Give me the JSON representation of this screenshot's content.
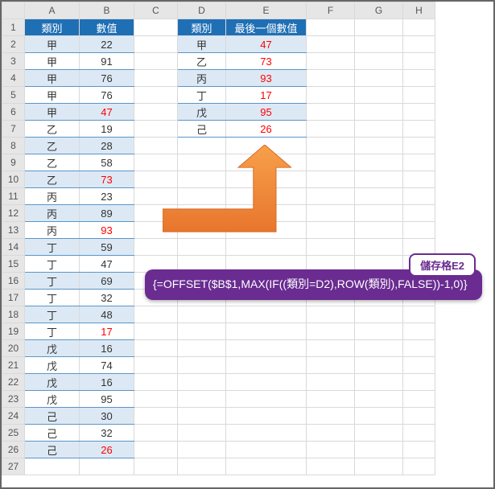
{
  "columns": [
    "A",
    "B",
    "C",
    "D",
    "E",
    "F",
    "G",
    "H"
  ],
  "tableA": {
    "headers": {
      "cat": "類別",
      "val": "數值"
    },
    "rows": [
      {
        "cat": "甲",
        "val": "22"
      },
      {
        "cat": "甲",
        "val": "91"
      },
      {
        "cat": "甲",
        "val": "76"
      },
      {
        "cat": "甲",
        "val": "76"
      },
      {
        "cat": "甲",
        "val": "47",
        "red": true
      },
      {
        "cat": "乙",
        "val": "19"
      },
      {
        "cat": "乙",
        "val": "28"
      },
      {
        "cat": "乙",
        "val": "58"
      },
      {
        "cat": "乙",
        "val": "73",
        "red": true
      },
      {
        "cat": "丙",
        "val": "23"
      },
      {
        "cat": "丙",
        "val": "89"
      },
      {
        "cat": "丙",
        "val": "93",
        "red": true
      },
      {
        "cat": "丁",
        "val": "59"
      },
      {
        "cat": "丁",
        "val": "47"
      },
      {
        "cat": "丁",
        "val": "69"
      },
      {
        "cat": "丁",
        "val": "32"
      },
      {
        "cat": "丁",
        "val": "48"
      },
      {
        "cat": "丁",
        "val": "17",
        "red": true
      },
      {
        "cat": "戊",
        "val": "16"
      },
      {
        "cat": "戊",
        "val": "74"
      },
      {
        "cat": "戊",
        "val": "16"
      },
      {
        "cat": "戊",
        "val": "95"
      },
      {
        "cat": "己",
        "val": "30"
      },
      {
        "cat": "己",
        "val": "32"
      },
      {
        "cat": "己",
        "val": "26",
        "red": true
      }
    ]
  },
  "tableD": {
    "headers": {
      "cat": "類別",
      "val": "最後一個數值"
    },
    "rows": [
      {
        "cat": "甲",
        "val": "47"
      },
      {
        "cat": "乙",
        "val": "73"
      },
      {
        "cat": "丙",
        "val": "93"
      },
      {
        "cat": "丁",
        "val": "17"
      },
      {
        "cat": "戊",
        "val": "95"
      },
      {
        "cat": "己",
        "val": "26"
      }
    ]
  },
  "callout": {
    "tag": "儲存格E2",
    "formula": "{=OFFSET($B$1,MAX(IF((類別=D2),ROW(類別),FALSE))-1,0)}"
  },
  "rowCount": 27
}
